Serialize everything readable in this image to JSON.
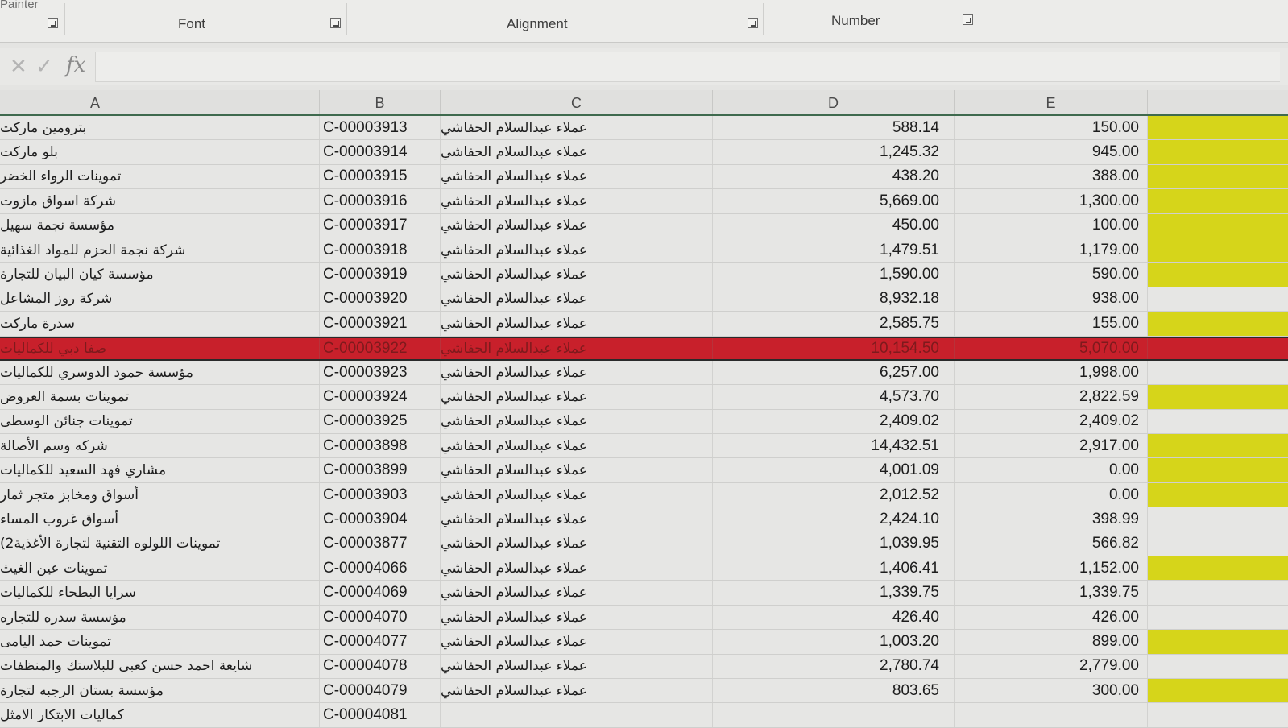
{
  "ribbon": {
    "painter_label": "Painter",
    "groups": [
      {
        "label": "Font"
      },
      {
        "label": "Alignment"
      },
      {
        "label": "Number"
      }
    ]
  },
  "formula_bar": {
    "cancel_icon": "x-icon",
    "enter_icon": "check-icon",
    "function_label": "fx",
    "value": ""
  },
  "columns": [
    "A",
    "B",
    "C",
    "D",
    "E"
  ],
  "highlight_color": "#d6d51a",
  "selected_row_color": "#c8202b",
  "rows": [
    {
      "name": "بترومين ماركت",
      "code": "C-00003913",
      "group": "عملاء عبدالسلام الحفاشي",
      "d": "588.14",
      "e": "150.00",
      "hl": true,
      "sel": false
    },
    {
      "name": "بلو ماركت",
      "code": "C-00003914",
      "group": "عملاء عبدالسلام الحفاشي",
      "d": "1,245.32",
      "e": "945.00",
      "hl": true,
      "sel": false
    },
    {
      "name": "تموينات الرواء الخضر",
      "code": "C-00003915",
      "group": "عملاء عبدالسلام الحفاشي",
      "d": "438.20",
      "e": "388.00",
      "hl": true,
      "sel": false
    },
    {
      "name": "شركة اسواق مازوت",
      "code": "C-00003916",
      "group": "عملاء عبدالسلام الحفاشي",
      "d": "5,669.00",
      "e": "1,300.00",
      "hl": true,
      "sel": false
    },
    {
      "name": "مؤسسة نجمة سهيل",
      "code": "C-00003917",
      "group": "عملاء عبدالسلام الحفاشي",
      "d": "450.00",
      "e": "100.00",
      "hl": true,
      "sel": false
    },
    {
      "name": "شركة نجمة الحزم للمواد الغذائية",
      "code": "C-00003918",
      "group": "عملاء عبدالسلام الحفاشي",
      "d": "1,479.51",
      "e": "1,179.00",
      "hl": true,
      "sel": false
    },
    {
      "name": "مؤسسة كيان البيان للتجارة",
      "code": "C-00003919",
      "group": "عملاء عبدالسلام الحفاشي",
      "d": "1,590.00",
      "e": "590.00",
      "hl": true,
      "sel": false
    },
    {
      "name": "شركة روز المشاعل",
      "code": "C-00003920",
      "group": "عملاء عبدالسلام الحفاشي",
      "d": "8,932.18",
      "e": "938.00",
      "hl": false,
      "sel": false
    },
    {
      "name": "سدرة ماركت",
      "code": "C-00003921",
      "group": "عملاء عبدالسلام الحفاشي",
      "d": "2,585.75",
      "e": "155.00",
      "hl": true,
      "sel": false
    },
    {
      "name": "صفا دبي للكماليات",
      "code": "C-00003922",
      "group": "عملاء عبدالسلام الحفاشي",
      "d": "10,154.50",
      "e": "5,070.00",
      "hl": false,
      "sel": true
    },
    {
      "name": "مؤسسة حمود الدوسري للكماليات",
      "code": "C-00003923",
      "group": "عملاء عبدالسلام الحفاشي",
      "d": "6,257.00",
      "e": "1,998.00",
      "hl": false,
      "sel": false
    },
    {
      "name": "تموينات بسمة العروض",
      "code": "C-00003924",
      "group": "عملاء عبدالسلام الحفاشي",
      "d": "4,573.70",
      "e": "2,822.59",
      "hl": true,
      "sel": false
    },
    {
      "name": "تموينات جنائن الوسطى",
      "code": "C-00003925",
      "group": "عملاء عبدالسلام الحفاشي",
      "d": "2,409.02",
      "e": "2,409.02",
      "hl": false,
      "sel": false
    },
    {
      "name": "شركه وسم الأصالة",
      "code": "C-00003898",
      "group": "عملاء عبدالسلام الحفاشي",
      "d": "14,432.51",
      "e": "2,917.00",
      "hl": true,
      "sel": false
    },
    {
      "name": "مشاري فهد السعيد للكماليات",
      "code": "C-00003899",
      "group": "عملاء عبدالسلام الحفاشي",
      "d": "4,001.09",
      "e": "0.00",
      "hl": true,
      "sel": false
    },
    {
      "name": "أسواق ومخابز متجر ثمار",
      "code": "C-00003903",
      "group": "عملاء عبدالسلام الحفاشي",
      "d": "2,012.52",
      "e": "0.00",
      "hl": true,
      "sel": false
    },
    {
      "name": "أسواق غروب المساء",
      "code": "C-00003904",
      "group": "عملاء عبدالسلام الحفاشي",
      "d": "2,424.10",
      "e": "398.99",
      "hl": false,
      "sel": false
    },
    {
      "name": "تموينات اللولوه التقنية لتجارة الأغذية2)",
      "code": "C-00003877",
      "group": "عملاء عبدالسلام الحفاشي",
      "d": "1,039.95",
      "e": "566.82",
      "hl": false,
      "sel": false
    },
    {
      "name": "تموينات عين الغيث",
      "code": "C-00004066",
      "group": "عملاء عبدالسلام الحفاشي",
      "d": "1,406.41",
      "e": "1,152.00",
      "hl": true,
      "sel": false
    },
    {
      "name": "سرايا البطحاء للكماليات",
      "code": "C-00004069",
      "group": "عملاء عبدالسلام الحفاشي",
      "d": "1,339.75",
      "e": "1,339.75",
      "hl": false,
      "sel": false
    },
    {
      "name": "مؤسسة سدره للتجاره",
      "code": "C-00004070",
      "group": "عملاء عبدالسلام الحفاشي",
      "d": "426.40",
      "e": "426.00",
      "hl": false,
      "sel": false
    },
    {
      "name": "تموينات حمد اليامى",
      "code": "C-00004077",
      "group": "عملاء عبدالسلام الحفاشي",
      "d": "1,003.20",
      "e": "899.00",
      "hl": true,
      "sel": false
    },
    {
      "name": "شايعة احمد حسن كعبى للبلاستك والمنظفات",
      "code": "C-00004078",
      "group": "عملاء عبدالسلام الحفاشي",
      "d": "2,780.74",
      "e": "2,779.00",
      "hl": false,
      "sel": false
    },
    {
      "name": "مؤسسة بستان الرجبه لتجارة",
      "code": "C-00004079",
      "group": "عملاء عبدالسلام الحفاشي",
      "d": "803.65",
      "e": "300.00",
      "hl": true,
      "sel": false
    },
    {
      "name": "كماليات الابتكار الامثل",
      "code": "C-00004081",
      "group": "",
      "d": "",
      "e": "",
      "hl": false,
      "sel": false
    }
  ]
}
